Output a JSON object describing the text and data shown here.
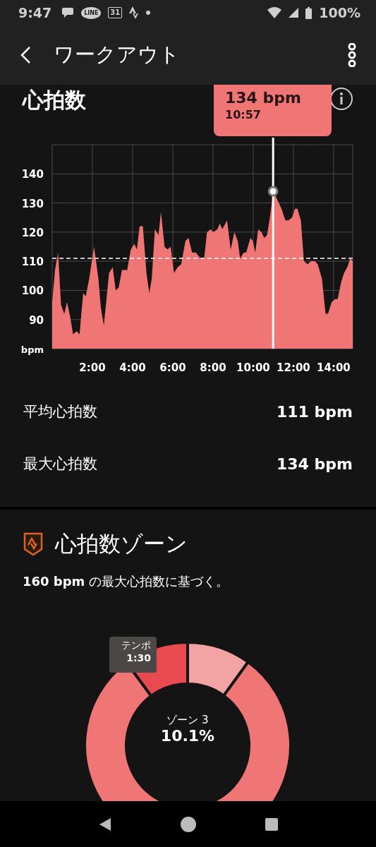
{
  "status_bar": {
    "time": "9:47",
    "line_label": "LINE",
    "calendar_day": "31",
    "battery": "100%"
  },
  "app_bar": {
    "title": "ワークアウト"
  },
  "heart_rate": {
    "title": "心拍数",
    "tooltip": {
      "value": "134 bpm",
      "time": "10:57"
    },
    "chart_data": {
      "type": "area",
      "ylabel": "bpm",
      "x": [
        0,
        0.14,
        0.29,
        0.44,
        0.6,
        0.74,
        0.89,
        1.04,
        1.22,
        1.36,
        1.54,
        1.67,
        1.84,
        2.08,
        2.3,
        2.42,
        2.57,
        2.83,
        3.01,
        3.16,
        3.31,
        3.47,
        3.73,
        3.91,
        4.09,
        4.21,
        4.35,
        4.51,
        4.69,
        4.83,
        4.95,
        5.11,
        5.29,
        5.41,
        5.59,
        5.73,
        5.89,
        6.06,
        6.24,
        6.42,
        6.63,
        6.78,
        6.96,
        7.14,
        7.38,
        7.56,
        7.7,
        7.89,
        8.01,
        8.22,
        8.34,
        8.46,
        8.7,
        8.88,
        9.06,
        9.23,
        9.35,
        9.53,
        9.65,
        9.86,
        9.98,
        10.1,
        10.25,
        10.41,
        10.55,
        10.69,
        10.85,
        10.99,
        11.21,
        11.41,
        11.6,
        11.75,
        11.93,
        12.08,
        12.2,
        12.37,
        12.52,
        12.7,
        12.88,
        13.06,
        13.21,
        13.42,
        13.6,
        13.72,
        13.9,
        14.08,
        14.2,
        14.38,
        14.52,
        14.68,
        14.83,
        14.95
      ],
      "series": [
        {
          "color": "#f07575",
          "values": [
            96,
            107,
            113,
            95,
            92,
            96,
            91,
            85,
            86,
            85,
            99,
            98,
            104,
            115,
            104,
            94,
            88,
            106,
            108,
            100,
            101,
            107,
            107,
            114,
            116,
            114,
            122,
            122,
            106,
            99,
            104,
            121,
            119,
            127,
            115,
            114,
            115,
            106,
            108,
            109,
            117,
            118,
            113,
            113,
            111,
            111,
            120,
            121,
            120,
            121,
            123,
            121,
            124,
            114,
            120,
            117,
            111,
            113,
            113,
            118,
            117,
            113,
            121,
            120,
            118,
            119,
            126,
            134,
            131,
            128,
            124,
            124,
            125,
            128,
            128,
            124,
            110,
            109,
            110,
            110,
            109,
            104,
            92,
            92,
            96,
            97,
            97,
            103,
            106,
            108,
            111,
            110
          ]
        }
      ],
      "xlim": [
        0,
        14.95
      ],
      "ylim": [
        80,
        150
      ],
      "xticks": [
        {
          "value": 2,
          "label": "2:00"
        },
        {
          "value": 4,
          "label": "4:00"
        },
        {
          "value": 6,
          "label": "6:00"
        },
        {
          "value": 8,
          "label": "8:00"
        },
        {
          "value": 10,
          "label": "10:00"
        },
        {
          "value": 12,
          "label": "12:00"
        },
        {
          "value": 14,
          "label": "14:00"
        }
      ],
      "yticks": [
        90,
        100,
        110,
        120,
        130,
        140
      ],
      "grid": true,
      "ref_lines": [
        {
          "axis": "y",
          "value": 111
        },
        {
          "axis": "x",
          "value": 10.99
        }
      ]
    },
    "stats": [
      {
        "label": "平均心拍数",
        "value": "111 bpm"
      },
      {
        "label": "最大心拍数",
        "value": "134 bpm"
      }
    ]
  },
  "zones": {
    "title": "心拍数ゾーン",
    "subtitle": "**160 bpm** の最大心拍数に基づく。",
    "tooltip": {
      "zone": "テンポ",
      "time": "1:30"
    },
    "center": {
      "label": "ゾーン 3",
      "percent": "10.1%"
    }
  }
}
